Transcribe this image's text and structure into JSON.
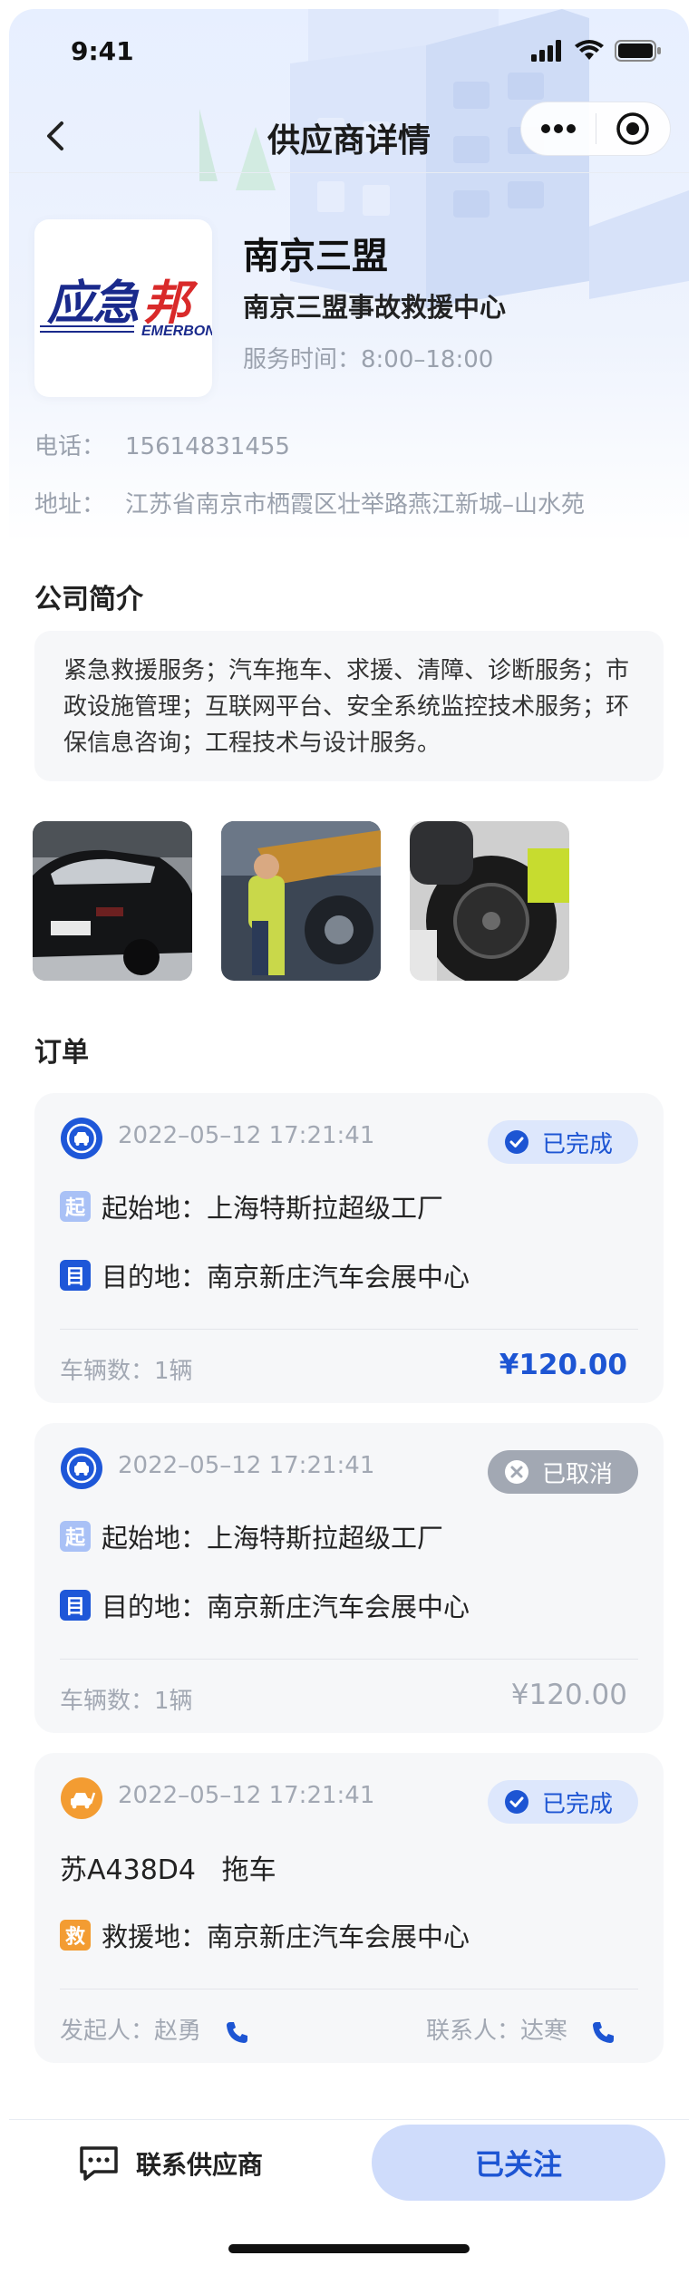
{
  "status_bar": {
    "time": "9:41"
  },
  "nav": {
    "title": "供应商详情"
  },
  "supplier": {
    "logo_text": "应急邦",
    "logo_sub": "EMERBOND",
    "name": "南京三盟",
    "full_name": "南京三盟事故救援中心",
    "service_time": "服务时间：8:00–18:00",
    "phone_label": "电话：",
    "phone": "15614831455",
    "address_label": "地址：",
    "address": "江苏省南京市栖霞区壮举路燕江新城–山水苑"
  },
  "intro": {
    "title": "公司简介",
    "text": "紧急救援服务；汽车拖车、求援、清障、诊断服务；市政设施管理；互联网平台、安全系统监控技术服务；环保信息咨询；工程技术与设计服务。"
  },
  "orders": {
    "title": "订单",
    "items": [
      {
        "datetime": "2022–05–12  17:21:41",
        "status": "已完成",
        "start_tag": "起",
        "start": "起始地：上海特斯拉超级工厂",
        "end_tag": "目",
        "end": "目的地：南京新庄汽车会展中心",
        "vehicles": "车辆数：1辆",
        "price": "¥120.00"
      },
      {
        "datetime": "2022–05–12  17:21:41",
        "status": "已取消",
        "start_tag": "起",
        "start": "起始地：上海特斯拉超级工厂",
        "end_tag": "目",
        "end": "目的地：南京新庄汽车会展中心",
        "vehicles": "车辆数：1辆",
        "price": "¥120.00"
      },
      {
        "datetime": "2022–05–12  17:21:41",
        "status": "已完成",
        "plate": "苏A438D4   拖车",
        "rescue_tag": "救",
        "rescue": "救援地：南京新庄汽车会展中心",
        "initiator": "发起人：赵勇",
        "contact": "联系人：达寒"
      }
    ]
  },
  "bottom": {
    "contact": "联系供应商",
    "follow": "已关注"
  },
  "colors": {
    "accent": "#1d55d3",
    "badge_done_bg": "#dde7fc",
    "badge_cancel_bg": "#a2a8b3",
    "rescue_orange": "#f39c32"
  },
  "icons": [
    "signal-icon",
    "wifi-icon",
    "battery-icon",
    "back-arrow-icon",
    "more-icon",
    "close-target-icon",
    "car-service-icon",
    "tow-truck-icon",
    "check-circle-icon",
    "close-circle-icon",
    "phone-icon",
    "chat-icon"
  ]
}
